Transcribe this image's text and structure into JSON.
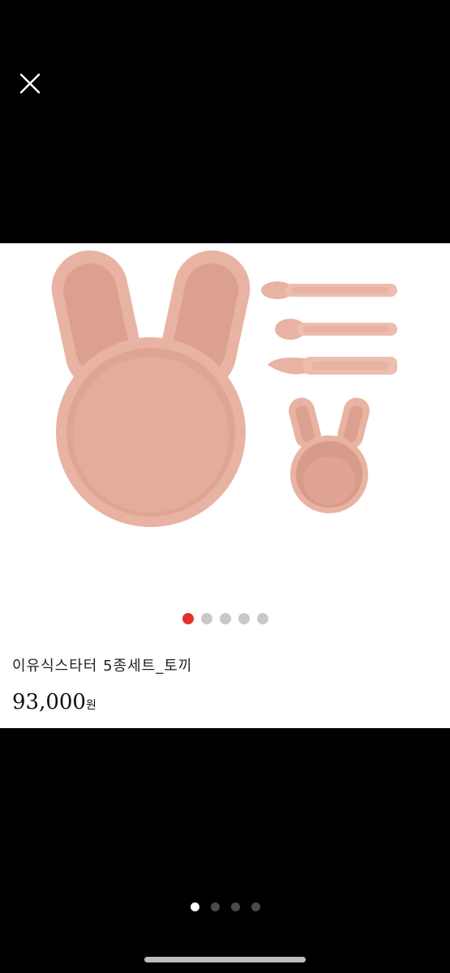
{
  "product": {
    "title": "이유식스타터 5종세트_토끼",
    "price": "93,000",
    "price_unit": "원"
  },
  "colors": {
    "silicone_pink": "#eab6a5",
    "silicone_pink_dark": "#dea291",
    "active_dot": "#e0312d",
    "inactive_dot": "#c8c8c8"
  },
  "carousel": {
    "total": 5,
    "active_index": 0
  },
  "pager": {
    "total": 4,
    "active_index": 0
  },
  "icons": {
    "close": "close-icon"
  }
}
